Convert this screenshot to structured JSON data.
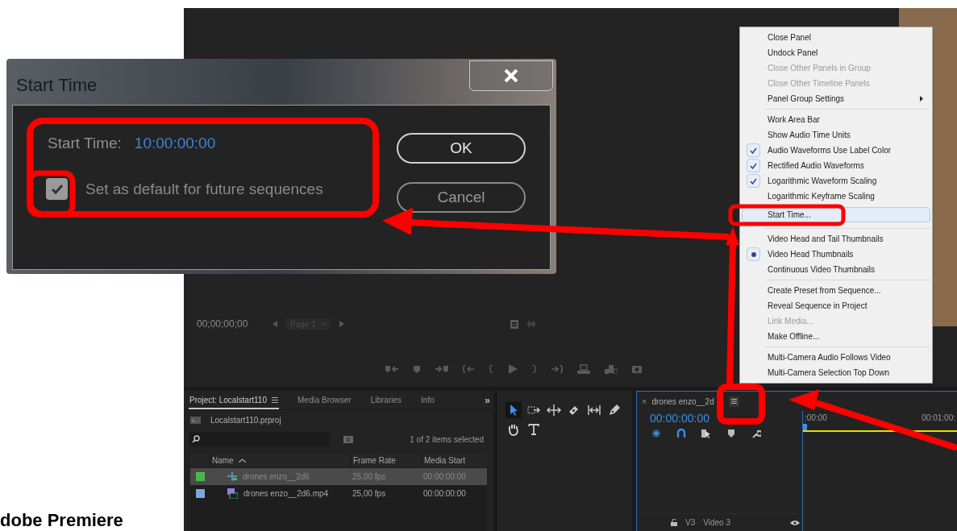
{
  "caption": "dobe Premiere",
  "monitor": {
    "timecode": "00;00;00;00",
    "page": "Page 1"
  },
  "project_panel": {
    "tabs": [
      {
        "label": "Project: Localstart110",
        "selected": true
      },
      {
        "label": "Media Browser",
        "selected": false
      },
      {
        "label": "Libraries",
        "selected": false
      },
      {
        "label": "Info",
        "selected": false
      }
    ],
    "overflow": "»",
    "file": "Localstart110.prproj",
    "selection_info": "1 of 2 items selected",
    "columns": [
      "Name",
      "Frame Rate",
      "Media Start"
    ],
    "rows": [
      {
        "kind": "sequence",
        "color": "#4cb84c",
        "name": "drones enzo__2d6",
        "frame_rate": "25,00 fps",
        "media_start": "00:00:00:00",
        "selected": true
      },
      {
        "kind": "clip",
        "color": "#7ea6dc",
        "name": "drones enzo__2d6.mp4",
        "frame_rate": "25,00 fps",
        "media_start": "00:00:00:00",
        "selected": false
      }
    ]
  },
  "timeline": {
    "close": "×",
    "tab": "drones enzo__2d",
    "timecode": "00:00:00:00",
    "ruler": [
      ":00:00",
      "00:01:00:"
    ],
    "tracks": [
      {
        "id": "V3",
        "name": "Video 3"
      }
    ]
  },
  "context_menu": {
    "groups": [
      [
        {
          "label": "Close Panel",
          "kind": "item",
          "checked": false,
          "disabled": false,
          "selected": false
        },
        {
          "label": "Undock Panel",
          "kind": "item",
          "checked": false,
          "disabled": false,
          "selected": false
        },
        {
          "label": "Close Other Panels in Group",
          "kind": "item",
          "checked": false,
          "disabled": true,
          "selected": false
        },
        {
          "label": "Close Other Timeline Panels",
          "kind": "item",
          "checked": false,
          "disabled": true,
          "selected": false
        },
        {
          "label": "Panel Group Settings",
          "kind": "submenu",
          "checked": false,
          "disabled": false,
          "selected": false
        }
      ],
      [
        {
          "label": "Work Area Bar",
          "kind": "item",
          "checked": false,
          "disabled": false,
          "selected": false
        },
        {
          "label": "Show Audio Time Units",
          "kind": "item",
          "checked": false,
          "disabled": false,
          "selected": false
        },
        {
          "label": "Audio Waveforms Use Label Color",
          "kind": "item",
          "checked": true,
          "disabled": false,
          "selected": false
        },
        {
          "label": "Rectified Audio Waveforms",
          "kind": "item",
          "checked": true,
          "disabled": false,
          "selected": false
        },
        {
          "label": "Logarithmic Waveform Scaling",
          "kind": "item",
          "checked": true,
          "disabled": false,
          "selected": false
        },
        {
          "label": "Logarithmic Keyframe Scaling",
          "kind": "item",
          "checked": false,
          "disabled": false,
          "selected": false
        },
        {
          "label": "Start Time...",
          "kind": "item",
          "checked": false,
          "disabled": false,
          "selected": true
        }
      ],
      [
        {
          "label": "Video Head and Tail Thumbnails",
          "kind": "radio",
          "checked": false,
          "disabled": false,
          "selected": false
        },
        {
          "label": "Video Head Thumbnails",
          "kind": "radio",
          "checked": true,
          "disabled": false,
          "selected": false
        },
        {
          "label": "Continuous Video Thumbnails",
          "kind": "radio",
          "checked": false,
          "disabled": false,
          "selected": false
        }
      ],
      [
        {
          "label": "Create Preset from Sequence...",
          "kind": "item",
          "checked": false,
          "disabled": false,
          "selected": false
        },
        {
          "label": "Reveal Sequence in Project",
          "kind": "item",
          "checked": false,
          "disabled": false,
          "selected": false
        },
        {
          "label": "Link Media...",
          "kind": "item",
          "checked": false,
          "disabled": true,
          "selected": false
        },
        {
          "label": "Make Offline...",
          "kind": "item",
          "checked": false,
          "disabled": false,
          "selected": false
        }
      ],
      [
        {
          "label": "Multi-Camera Audio Follows Video",
          "kind": "item",
          "checked": false,
          "disabled": false,
          "selected": false
        },
        {
          "label": "Multi-Camera Selection Top Down",
          "kind": "item",
          "checked": false,
          "disabled": false,
          "selected": false
        }
      ]
    ]
  },
  "dialog": {
    "title": "Start Time",
    "label": "Start Time:",
    "value": "10:00:00:00",
    "checkbox": {
      "label": "Set as default for future sequences",
      "checked": true
    },
    "buttons": [
      "OK",
      "Cancel"
    ]
  }
}
